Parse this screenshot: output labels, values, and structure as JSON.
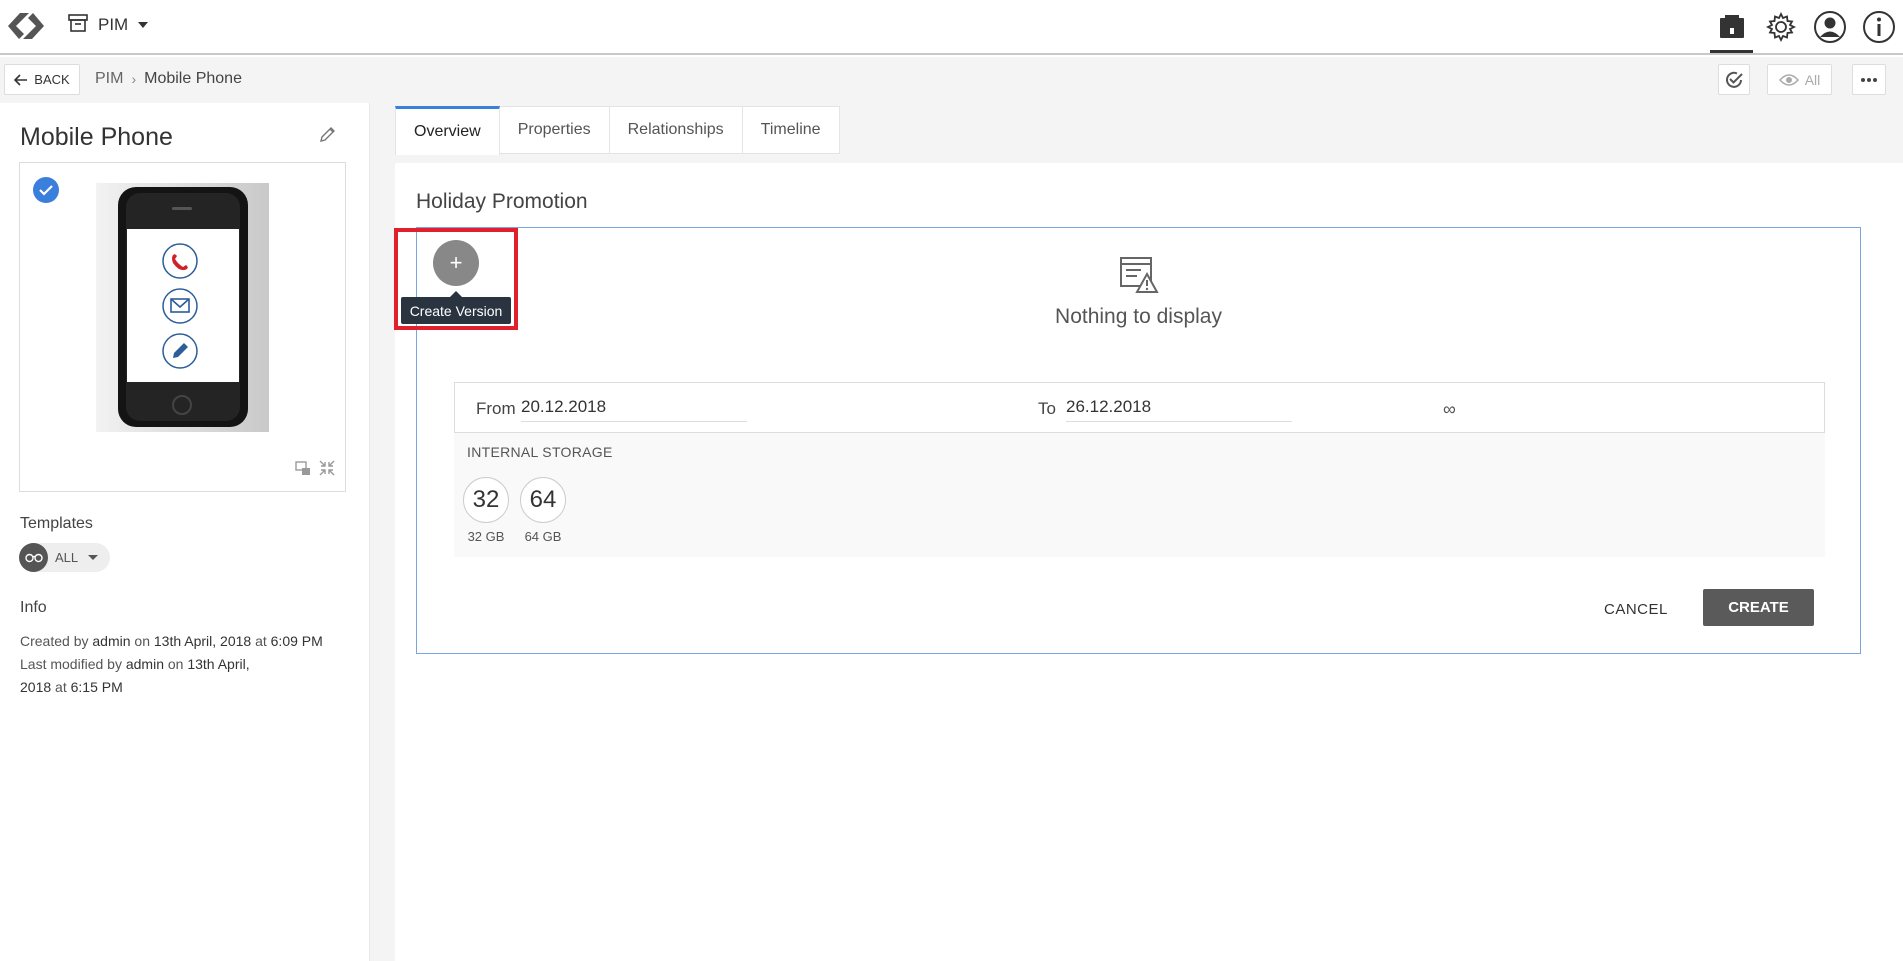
{
  "topbar": {
    "module_label": "PIM",
    "icons": [
      "archive-icon",
      "settings-gear-icon",
      "user-avatar-icon",
      "info-icon"
    ]
  },
  "breadcrumb_bar": {
    "back_label": "BACK",
    "crumbs": [
      "PIM",
      "Mobile Phone"
    ],
    "view_label": "All"
  },
  "sidebar": {
    "title": "Mobile Phone",
    "templates_label": "Templates",
    "templates_value": "ALL",
    "info_label": "Info",
    "info": {
      "created_prefix": "Created by",
      "created_by": "admin",
      "created_on_word": "on",
      "created_date": "13th April, 2018",
      "created_at_word": "at",
      "created_time": "6:09 PM",
      "modified_prefix": "Last modified by",
      "modified_by": "admin",
      "modified_on_word": "on",
      "modified_date_a": "13th April,",
      "modified_date_b": "2018",
      "modified_at_word": "at",
      "modified_time": "6:15 PM"
    }
  },
  "tabs": [
    "Overview",
    "Properties",
    "Relationships",
    "Timeline"
  ],
  "panel": {
    "title": "Holiday Promotion",
    "empty_text": "Nothing to display",
    "tooltip": "Create Version",
    "plus_symbol": "+",
    "from_label": "From",
    "from_value": "20.12.2018",
    "to_label": "To",
    "to_value": "26.12.2018",
    "infinity_symbol": "∞",
    "storage_label": "INTERNAL STORAGE",
    "storage_options": [
      {
        "value": "32",
        "caption": "32 GB"
      },
      {
        "value": "64",
        "caption": "64 GB"
      }
    ],
    "cancel_label": "CANCEL",
    "create_label": "CREATE"
  },
  "colors": {
    "accent": "#3b7fdc",
    "highlight": "#e0202d",
    "tooltip_bg": "#2a3440",
    "primary_button": "#5a5a5a"
  }
}
